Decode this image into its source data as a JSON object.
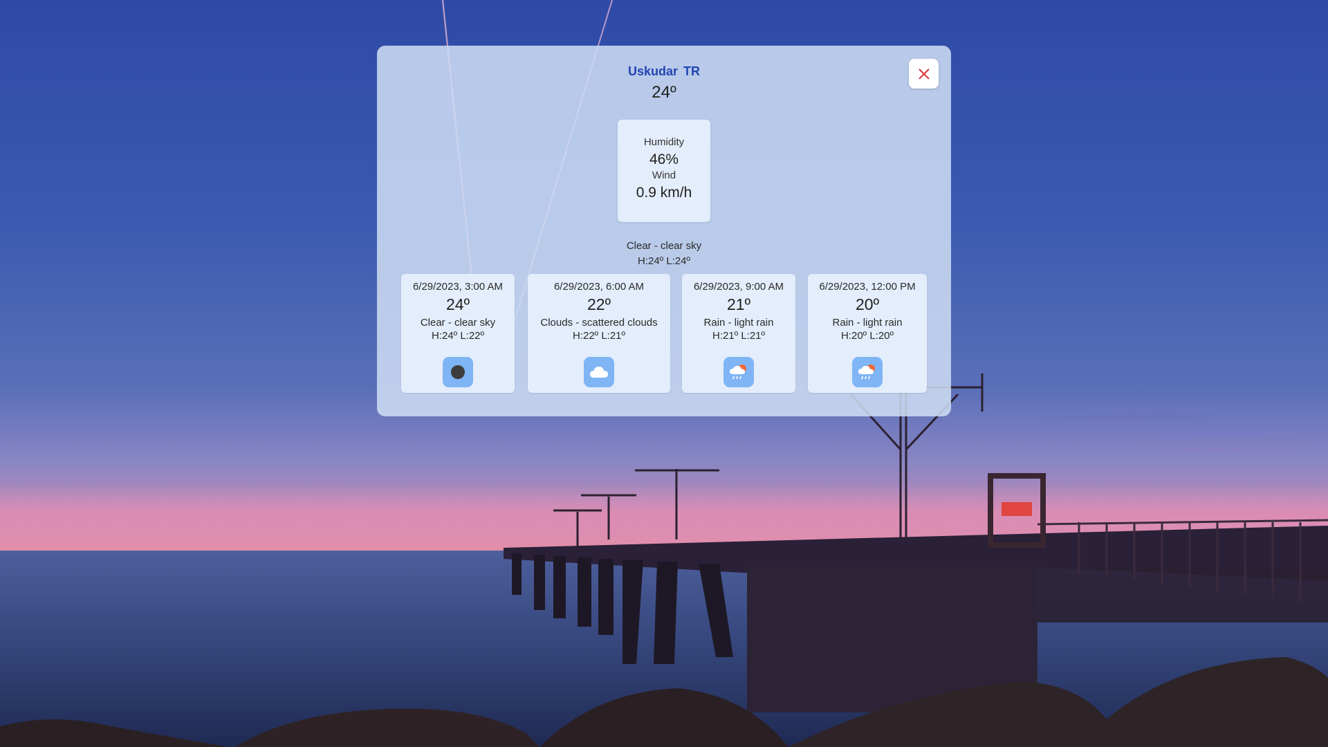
{
  "location": {
    "city": "Uskudar",
    "country": "TR"
  },
  "current": {
    "temperature": "24º",
    "humidity_label": "Humidity",
    "humidity": "46%",
    "wind_label": "Wind",
    "wind": "0.9 km/h",
    "condition": "Clear - clear sky",
    "high_low": "H:24º L:24º"
  },
  "forecast": [
    {
      "datetime": "6/29/2023, 3:00 AM",
      "temp": "24º",
      "condition": "Clear - clear sky",
      "high_low": "H:24º L:22º",
      "icon": "clear-night-icon"
    },
    {
      "datetime": "6/29/2023, 6:00 AM",
      "temp": "22º",
      "condition": "Clouds - scattered clouds",
      "high_low": "H:22º L:21º",
      "icon": "cloud-icon"
    },
    {
      "datetime": "6/29/2023, 9:00 AM",
      "temp": "21º",
      "condition": "Rain - light rain",
      "high_low": "H:21º L:21º",
      "icon": "rain-sun-icon"
    },
    {
      "datetime": "6/29/2023, 12:00 PM",
      "temp": "20º",
      "condition": "Rain - light rain",
      "high_low": "H:20º L:20º",
      "icon": "rain-sun-icon"
    }
  ],
  "colors": {
    "accent": "#2345b3",
    "close": "#e0383e",
    "icon_bg": "#7fb5f5"
  },
  "close_icon": "close-icon"
}
